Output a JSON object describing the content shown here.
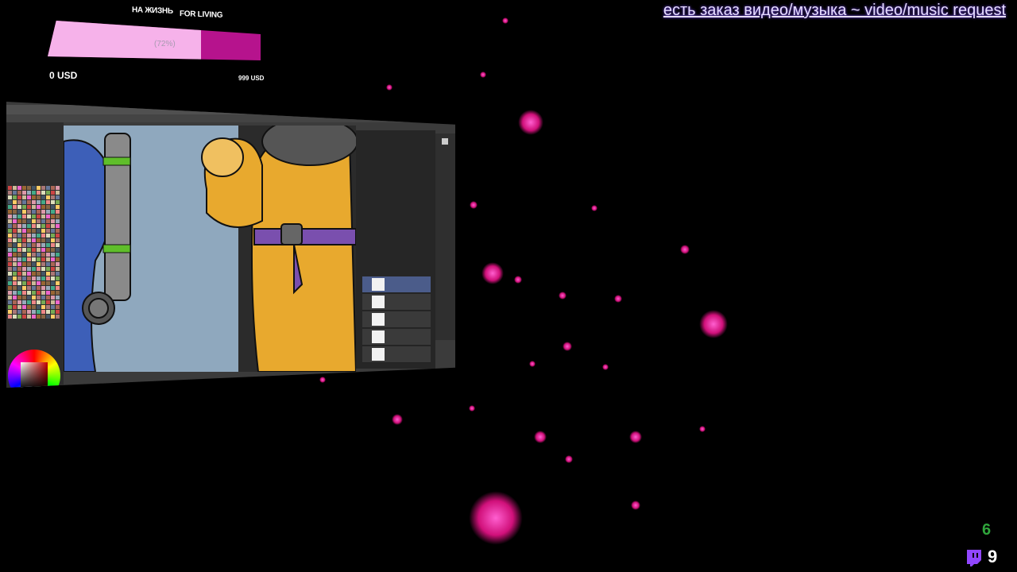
{
  "goal": {
    "label_ru": "НА ЖИЗНЬ",
    "label_en": "FOR LIVING",
    "percent_text": "(72%)",
    "progress": 0.72,
    "min_text": "0 USD",
    "max_text": "999 USD",
    "fill_color": "#f6b2ea",
    "bar_color": "#b6138d"
  },
  "request_banner": {
    "text": "есть заказ видео/музыка ~ video/music request"
  },
  "counters": {
    "green_count": "6",
    "white_count": "9",
    "icon": "twitch-icon"
  },
  "app": {
    "icon_names": [
      "color-wheel-icon",
      "brush-icon",
      "layer-icon"
    ]
  },
  "colors": {
    "background": "#000000",
    "particle": "#d0107a",
    "accent": "#e6dcff"
  }
}
